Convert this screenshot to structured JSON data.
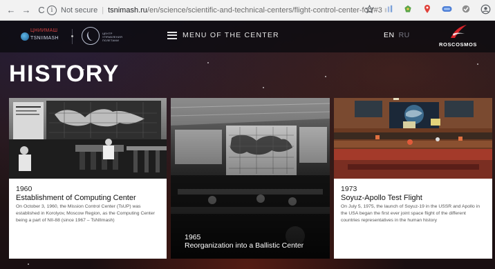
{
  "browser": {
    "nav": {
      "back": "←",
      "forward": "→",
      "reload": "C"
    },
    "security_label": "Not secure",
    "url_domain": "tsnimash.ru",
    "url_path": "/en/science/scientific-and-technical-centers/flight-control-center-fcc/#3",
    "right_icons": [
      "star-icon",
      "extension-icon",
      "extension-icon",
      "location-icon",
      "extension-icon",
      "extension-icon",
      "account-icon"
    ]
  },
  "header": {
    "logo_tsni_line1": "ЦНИИМАШ",
    "logo_tsni_line2": "TSNIIMASH",
    "logo_mcc_lines": [
      "ЦЕНТР",
      "УПРАВЛЕНИЯ",
      "ПОЛЕТАМИ"
    ],
    "menu_label": "MENU OF THE CENTER",
    "lang_en": "EN",
    "lang_ru": "RU",
    "roscosmos": "ROSCOSMOS",
    "colors": {
      "roscosmos_red": "#d8232a",
      "header_bg": "#0a0a0e"
    }
  },
  "page": {
    "title": "HISTORY"
  },
  "cards": [
    {
      "year": "1960",
      "title": "Establishment of Computing Center",
      "text": "On October 3, 1960, the Mission Control Center (TsUP) was established in Korolyov, Moscow Region, as the Computing Center being a part of NII-88 (since 1967 – TsNIImash)"
    },
    {
      "year": "1965",
      "title": "Reorganization into a Ballistic Center",
      "text": ""
    },
    {
      "year": "1973",
      "title": "Soyuz-Apollo Test Flight",
      "text": "On July 5, 1975, the launch of Soyuz-19 in the USSR and Apollo in the USA began the first ever joint space flight of the different countries representatives in the human history"
    }
  ]
}
